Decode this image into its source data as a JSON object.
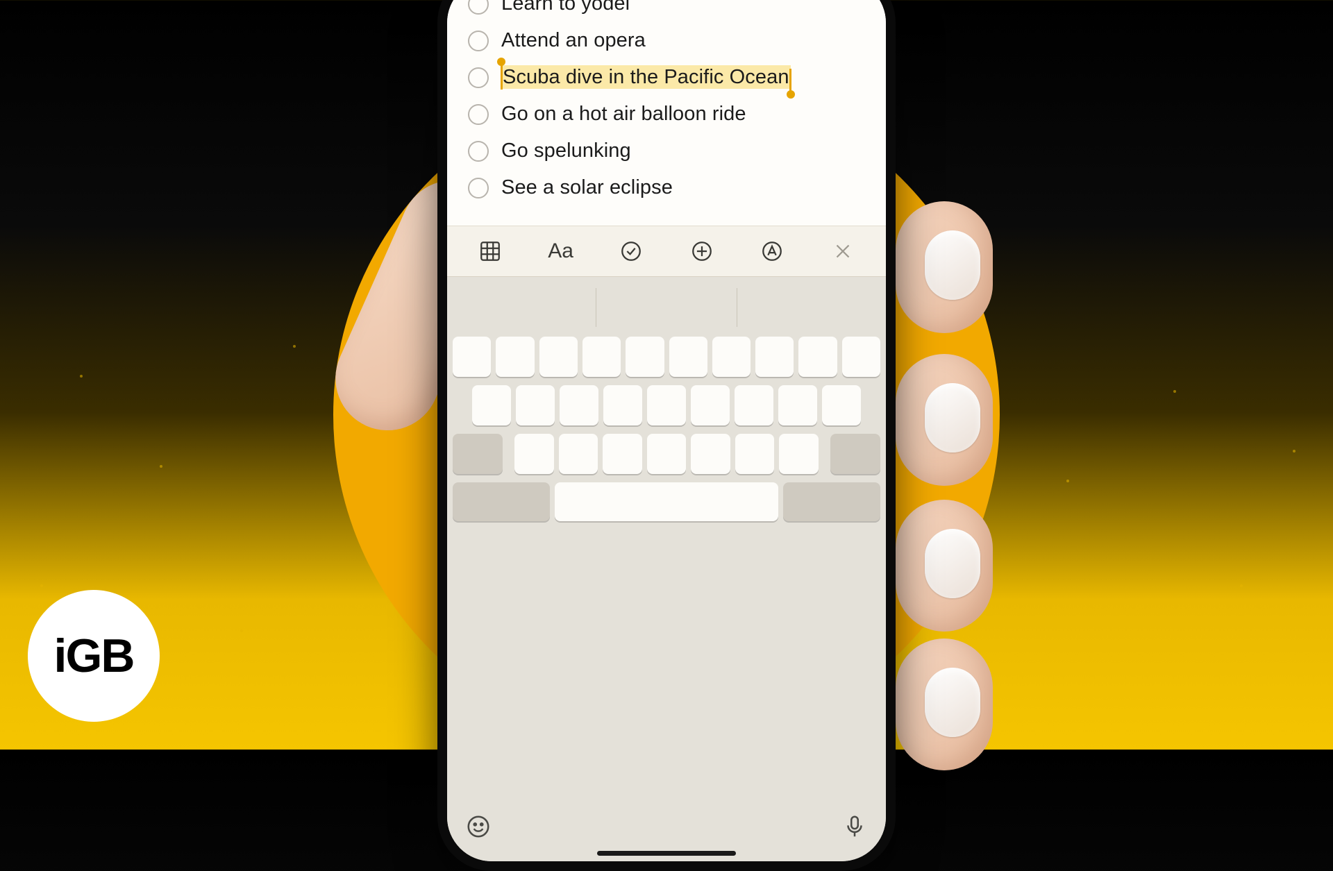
{
  "logo_text": "iGB",
  "notes": {
    "items": [
      {
        "text": "Learn to yodel",
        "selected": false
      },
      {
        "text": "Attend an opera",
        "selected": false
      },
      {
        "text": "Scuba dive in the Pacific Ocean",
        "selected": true
      },
      {
        "text": "Go on a hot air balloon ride",
        "selected": false
      },
      {
        "text": "Go spelunking",
        "selected": false
      },
      {
        "text": "See a solar eclipse",
        "selected": false
      }
    ]
  },
  "toolbar": {
    "icons": {
      "table": "table-icon",
      "format": "Aa",
      "checklist": "check-circle-icon",
      "add": "plus-circle-icon",
      "markup": "pencil-circle-icon",
      "close": "close-icon"
    }
  },
  "keyboard": {
    "bottom_icons": {
      "emoji": "emoji-icon",
      "mic": "microphone-icon"
    }
  },
  "colors": {
    "accent": "#e6a400",
    "highlight": "#fbe9a8",
    "halo": "#f2a900",
    "background_dark": "#000000"
  }
}
